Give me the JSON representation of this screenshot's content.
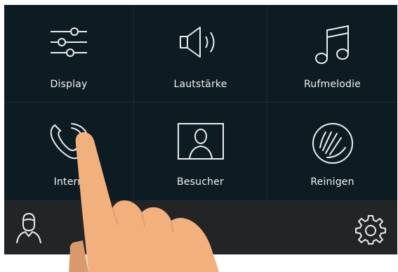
{
  "tiles": [
    {
      "label": "Display",
      "icon": "sliders-icon"
    },
    {
      "label": "Lautstärke",
      "icon": "speaker-icon"
    },
    {
      "label": "Rufmelodie",
      "icon": "music-note-icon"
    },
    {
      "label": "Intern",
      "icon": "phone-icon"
    },
    {
      "label": "Besucher",
      "icon": "visitor-icon"
    },
    {
      "label": "Reinigen",
      "icon": "clean-hand-icon"
    }
  ],
  "bottom_bar": {
    "left_icon": "user-profile-icon",
    "right_icon": "gear-icon"
  },
  "colors": {
    "screen_background": "#0d1b22",
    "bottom_bar": "#222426",
    "icon_color": "#e9eef0",
    "hand_skin": "#f2b07d"
  }
}
